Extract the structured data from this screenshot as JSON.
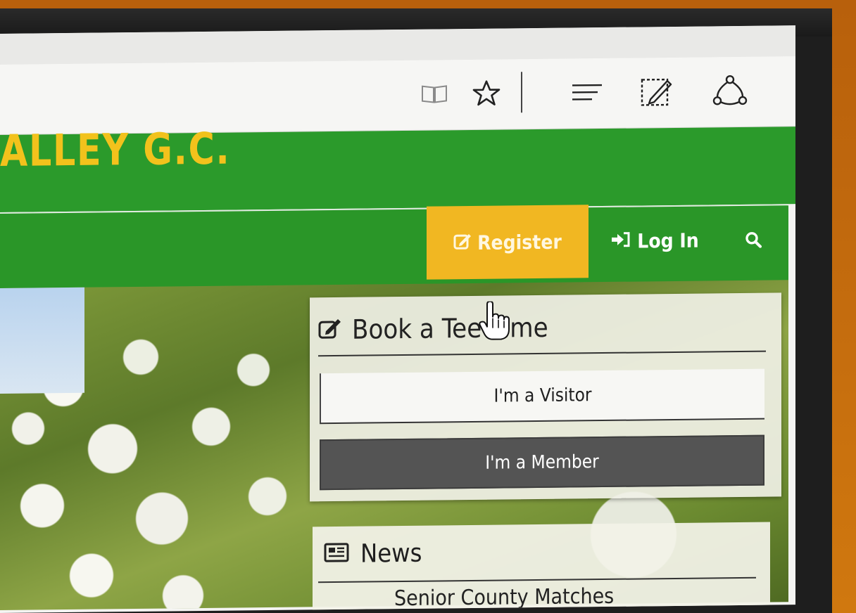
{
  "browser": {
    "icons": [
      "reading-view-icon",
      "favorite-star-icon",
      "hub-menu-icon",
      "web-note-icon",
      "share-icon"
    ]
  },
  "site": {
    "title": "ALLEY G.C.",
    "colors": {
      "header_green": "#2b9a2b",
      "title_yellow": "#f2c21c",
      "register_bg": "#f1b722"
    }
  },
  "nav": {
    "register": "Register",
    "login": "Log In"
  },
  "tee_card": {
    "title": "Book a Tee Time",
    "visitor_button": "I'm a Visitor",
    "member_button": "I'm a Member"
  },
  "news": {
    "title": "News",
    "first_item": "Senior County Matches"
  }
}
